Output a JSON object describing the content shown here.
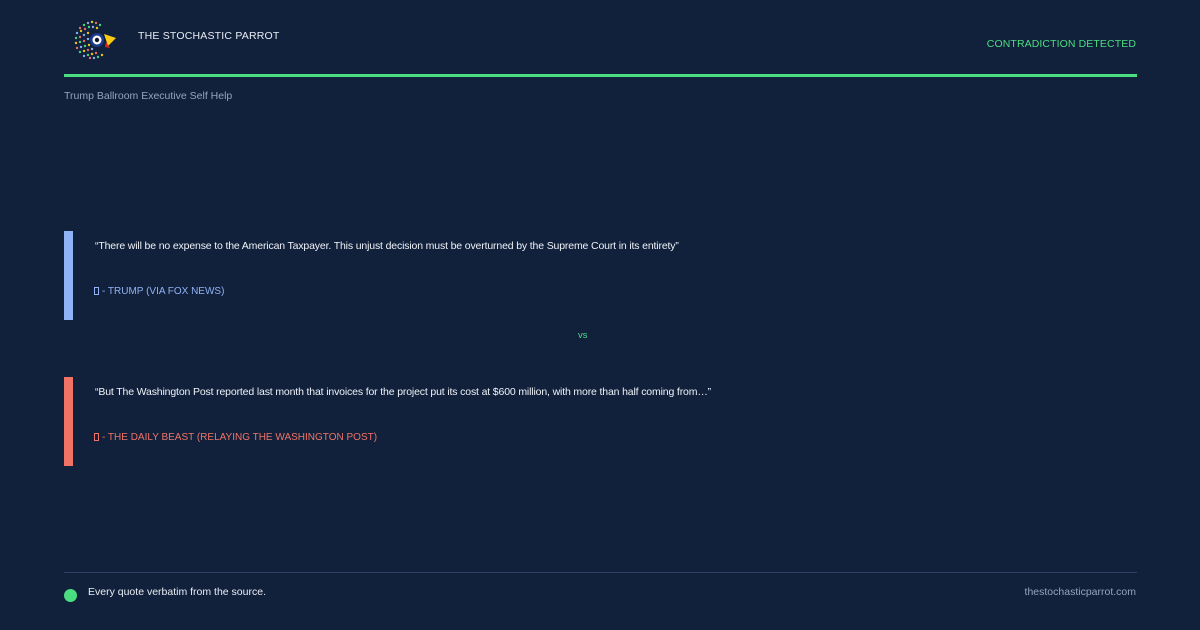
{
  "header": {
    "brand": "THE STOCHASTIC PARROT",
    "status": "CONTRADICTION DETECTED",
    "subtitle": "Trump Ballroom Executive Self Help"
  },
  "icons": {
    "logo": "parrot-logo-icon",
    "source_glyph": "missing-glyph-icon",
    "footer_dot": "status-dot-icon"
  },
  "colors": {
    "background": "#12213b",
    "accent": "#4ade80",
    "claim_a": "#8fb3f5",
    "claim_b": "#f07366"
  },
  "claims": [
    {
      "quote": "“There will be no expense to the American Taxpayer. This unjust decision must be overturned by the Supreme Court in its entirety”",
      "source": "- TRUMP (VIA FOX NEWS)"
    },
    {
      "quote": "“But The Washington Post reported last month that invoices for the project put its cost at $600 million, with more than half coming from…”",
      "source": "- THE DAILY BEAST (RELAYING THE WASHINGTON POST)"
    }
  ],
  "versus": "vs",
  "footer": {
    "note": "Every quote verbatim from the source.",
    "site": "thestochasticparrot.com"
  }
}
